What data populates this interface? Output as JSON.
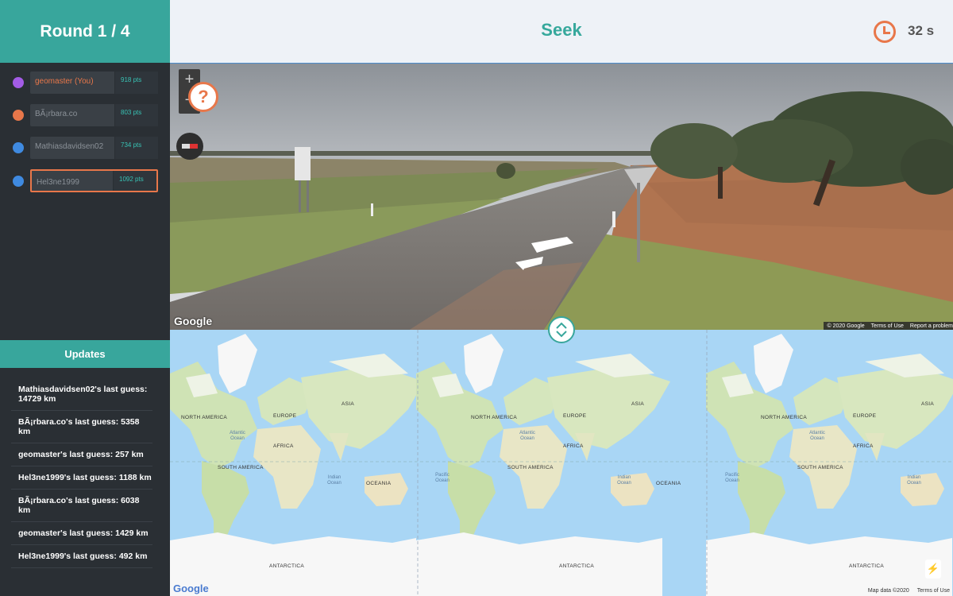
{
  "round": {
    "label": "Round 1 / 4"
  },
  "phase": {
    "label": "Seek"
  },
  "timer": {
    "value": "32 s",
    "icon": "clock-icon",
    "color": "#e8774a"
  },
  "accent_color": "#38a69c",
  "players": [
    {
      "name": "geomaster (You)",
      "points": "918 pts",
      "color": "#a35ce6",
      "is_you": true,
      "active": false
    },
    {
      "name": "BÃ¡rbara.co",
      "points": "803 pts",
      "color": "#e8774a",
      "is_you": false,
      "active": false
    },
    {
      "name": "Mathiasdavidsen02",
      "points": "734 pts",
      "color": "#3f8ae0",
      "is_you": false,
      "active": false
    },
    {
      "name": "Hel3ne1999",
      "points": "1092 pts",
      "color": "#3f8ae0",
      "is_you": false,
      "active": true
    }
  ],
  "updates": {
    "title": "Updates",
    "items": [
      "Mathiasdavidsen02's last guess: 14729 km",
      "BÃ¡rbara.co's last guess: 5358 km",
      "geomaster's last guess: 257 km",
      "Hel3ne1999's last guess: 1188 km",
      "BÃ¡rbara.co's last guess: 6038 km",
      "geomaster's last guess: 1429 km",
      "Hel3ne1999's last guess: 492 km"
    ]
  },
  "street_view": {
    "zoom_in": "+",
    "zoom_out": "−",
    "help": "?",
    "logo": "Google",
    "copyright": "© 2020 Google",
    "terms": "Terms of Use",
    "report": "Report a problem"
  },
  "map": {
    "logo": "Google",
    "data_credit": "Map data ©2020",
    "terms": "Terms of Use",
    "labels": {
      "north_america": "NORTH AMERICA",
      "south_america": "SOUTH AMERICA",
      "europe": "EUROPE",
      "asia": "ASIA",
      "africa": "AFRICA",
      "oceania": "OCEANIA",
      "antarctica": "ANTARCTICA",
      "atlantic": "Atlantic Ocean",
      "pacific": "Pacific Ocean",
      "indian": "Indian Ocean"
    }
  }
}
